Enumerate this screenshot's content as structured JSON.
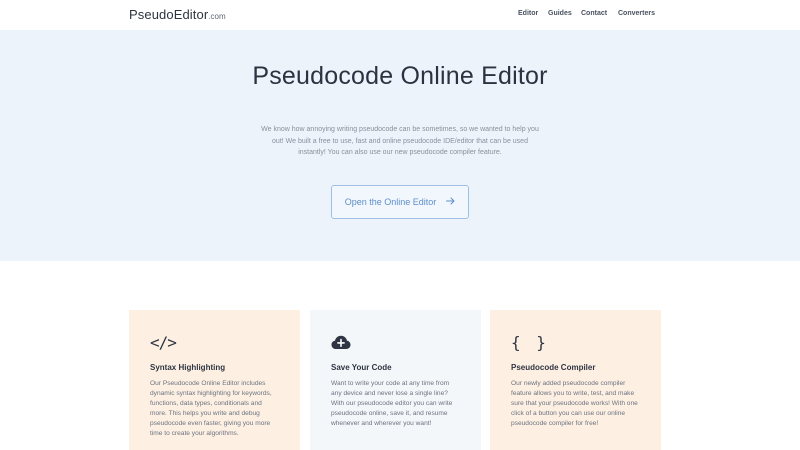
{
  "brand": {
    "name": "PseudoEditor",
    "suffix": ".com"
  },
  "nav": {
    "items": [
      {
        "label": "Editor"
      },
      {
        "label": "Guides"
      },
      {
        "label": "Contact"
      },
      {
        "label": "Converters"
      }
    ]
  },
  "hero": {
    "title": "Pseudocode Online Editor",
    "description": "We know how annoying writing pseudocode can be sometimes, so we wanted to help you out! We built a free to use, fast and online pseudocode IDE/editor that can be used instantly! You can also use our new pseudocode compiler feature.",
    "cta_label": "Open the Online Editor",
    "cta_icon": "arrow-right-icon"
  },
  "features": [
    {
      "icon": "code-icon",
      "icon_glyph": "</>",
      "title": "Syntax Highlighting",
      "text": "Our Pseudocode Online Editor includes dynamic syntax highlighting for keywords, functions, data types, conditionals and more. This helps you write and debug pseudocode even faster, giving you more time to create your algorithms."
    },
    {
      "icon": "cloud-upload-icon",
      "title": "Save Your Code",
      "text": "Want to write your code at any time from any device and never lose a single line? With our pseudocode editor you can write pseudocode online, save it, and resume whenever and wherever you want!"
    },
    {
      "icon": "curly-braces-icon",
      "icon_glyph": "{ }",
      "title": "Pseudocode Compiler",
      "text": "Our newly added pseudocode compiler feature allows you to write, test, and make sure that your pseudocode works! With one click of a button you can use our online pseudocode compiler for free!"
    }
  ],
  "colors": {
    "hero_bg": "#edf3fb",
    "card_warm": "#fdf0e3",
    "card_cool": "#f4f7fa",
    "accent": "#5d8fc8"
  }
}
